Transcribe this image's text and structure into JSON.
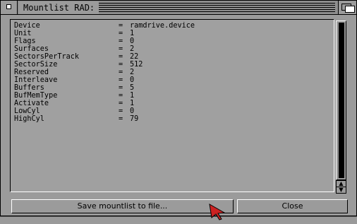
{
  "window": {
    "title": "Mountlist RAD:"
  },
  "mountlist": [
    {
      "key": "Device",
      "value": "ramdrive.device"
    },
    {
      "key": "Unit",
      "value": "1"
    },
    {
      "key": "Flags",
      "value": "0"
    },
    {
      "key": "Surfaces",
      "value": "2"
    },
    {
      "key": "SectorsPerTrack",
      "value": "22"
    },
    {
      "key": "SectorSize",
      "value": "512"
    },
    {
      "key": "Reserved",
      "value": "2"
    },
    {
      "key": "Interleave",
      "value": "0"
    },
    {
      "key": "Buffers",
      "value": "5"
    },
    {
      "key": "BufMemType",
      "value": "1"
    },
    {
      "key": "Activate",
      "value": "1"
    },
    {
      "key": "LowCyl",
      "value": "0"
    },
    {
      "key": "HighCyl",
      "value": "79"
    }
  ],
  "equals_sign": "=",
  "buttons": {
    "save_label": "Save mountlist to file...",
    "close_label": "Close"
  },
  "scrollbar": {
    "up_glyph": "▲",
    "down_glyph": "▼"
  },
  "colors": {
    "window_bg": "#9b9b9b",
    "knob": "#000000",
    "cursor": "#cc2222"
  }
}
